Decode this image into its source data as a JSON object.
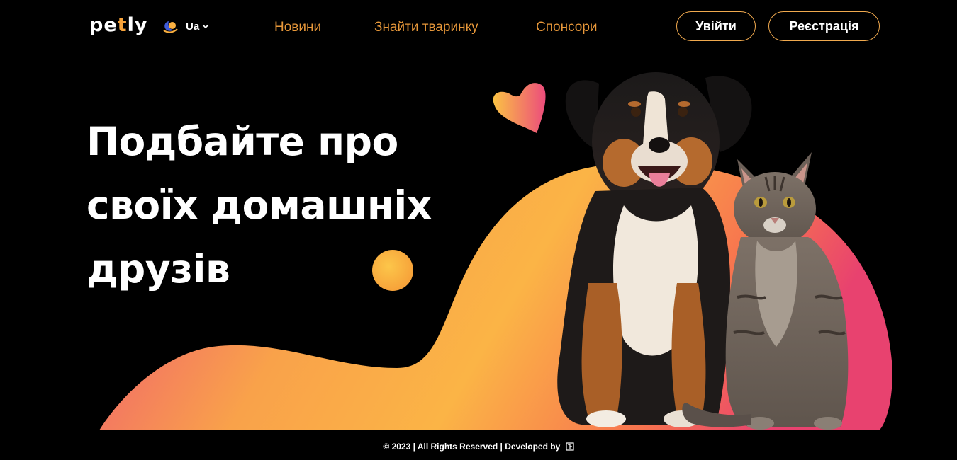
{
  "header": {
    "logo_prefix": "pe",
    "logo_accent": "t",
    "logo_suffix": "ly",
    "language": "Ua"
  },
  "nav": {
    "items": [
      {
        "label": "Новини"
      },
      {
        "label": "Знайти тваринку"
      },
      {
        "label": "Спонсори"
      }
    ]
  },
  "auth": {
    "login_label": "Увійти",
    "register_label": "Реєстрація"
  },
  "hero": {
    "line1": "Подбайте про",
    "line2": "своїх домашніх",
    "line3": "друзів"
  },
  "footer": {
    "text": "© 2023 | All Rights Reserved | Developed by"
  },
  "colors": {
    "background": "#000000",
    "accent_orange": "#f7a33a",
    "nav_text": "#e8983a",
    "button_border": "#f0a94e",
    "gradient_yellow": "#fbb040",
    "gradient_pink": "#e8426f"
  },
  "icons": {
    "theme": "moon-sun-icon",
    "language": "chevron-down-icon",
    "decor_heart": "heart-icon",
    "decor_circle": "circle-decoration"
  }
}
